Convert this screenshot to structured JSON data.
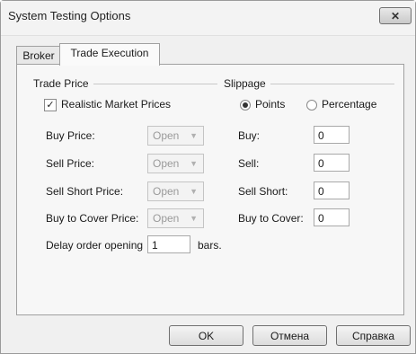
{
  "window": {
    "title": "System Testing Options"
  },
  "tabs": [
    {
      "label": "Broker"
    },
    {
      "label": "Trade Execution"
    }
  ],
  "trade_price": {
    "group_label": "Trade Price",
    "realistic_label": "Realistic Market Prices",
    "realistic_checked": true,
    "rows": [
      {
        "label": "Buy Price:",
        "value": "Open"
      },
      {
        "label": "Sell Price:",
        "value": "Open"
      },
      {
        "label": "Sell Short Price:",
        "value": "Open"
      },
      {
        "label": "Buy to Cover Price:",
        "value": "Open"
      }
    ],
    "delay_label": "Delay order opening",
    "delay_value": "1",
    "delay_unit": "bars."
  },
  "slippage": {
    "group_label": "Slippage",
    "options": [
      {
        "label": "Points",
        "selected": true
      },
      {
        "label": "Percentage",
        "selected": false
      }
    ],
    "rows": [
      {
        "label": "Buy:",
        "value": "0"
      },
      {
        "label": "Sell:",
        "value": "0"
      },
      {
        "label": "Sell Short:",
        "value": "0"
      },
      {
        "label": "Buy to Cover:",
        "value": "0"
      }
    ]
  },
  "buttons": {
    "ok": "OK",
    "cancel": "Отмена",
    "help": "Справка"
  }
}
